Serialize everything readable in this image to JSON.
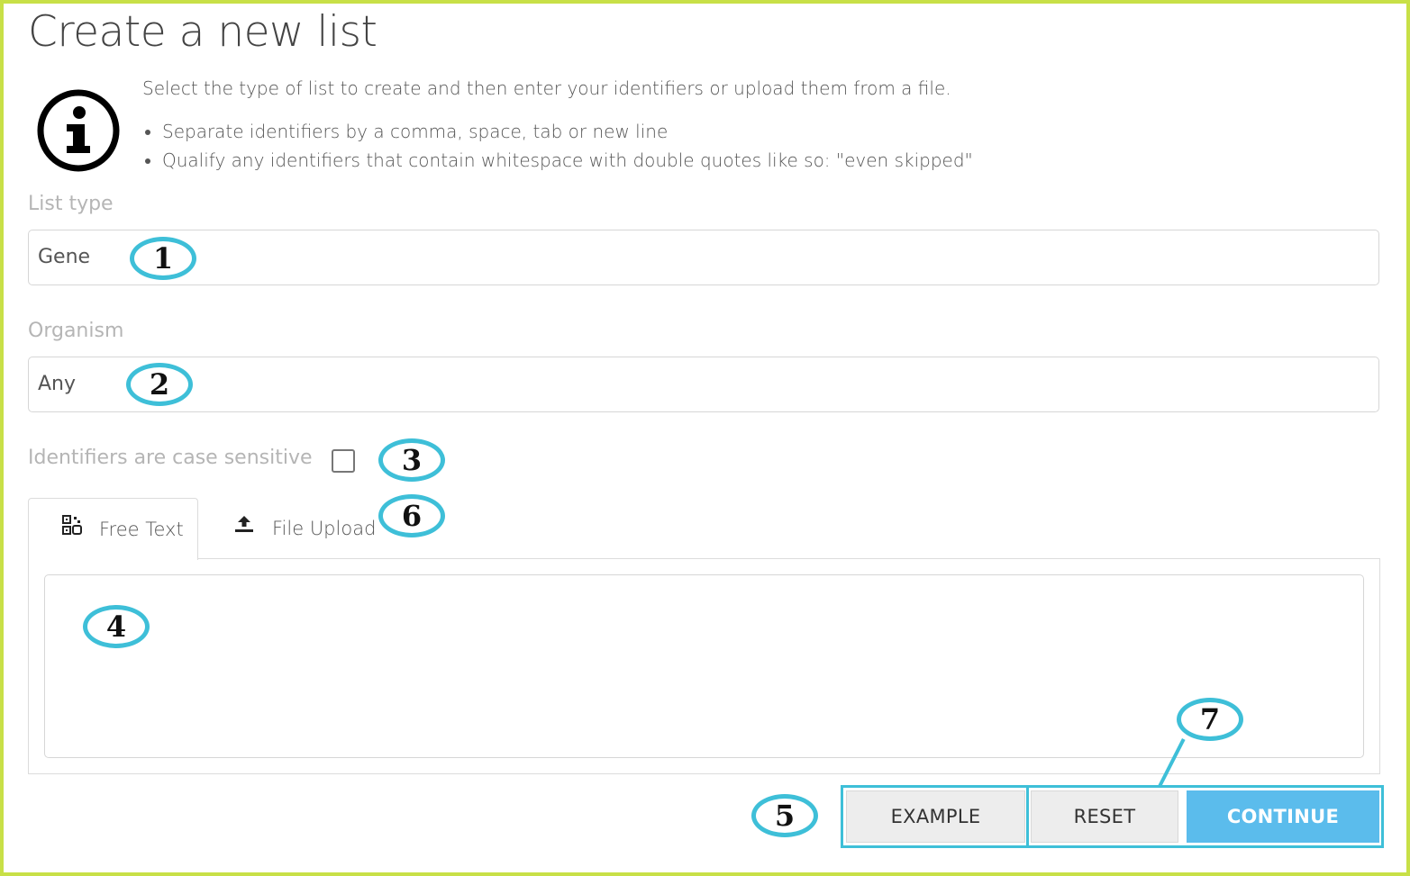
{
  "page": {
    "title": "Create a new list"
  },
  "info": {
    "icon": "info-circle-icon",
    "intro": "Select the type of list to create and then enter your identifiers or upload them from a file.",
    "bullets": [
      "Separate identifiers by a comma, space, tab or new line",
      "Qualify any identifiers that contain whitespace with double quotes like so: \"even skipped\""
    ]
  },
  "form": {
    "list_type": {
      "label": "List type",
      "value": "Gene"
    },
    "organism": {
      "label": "Organism",
      "value": "Any"
    },
    "case_sensitive": {
      "label": "Identifiers are case sensitive",
      "checked": false
    }
  },
  "tabs": [
    {
      "label": "Free Text",
      "icon": "qr-code-icon",
      "active": true
    },
    {
      "label": "File Upload",
      "icon": "upload-icon",
      "active": false
    }
  ],
  "free_text": {
    "value": ""
  },
  "buttons": {
    "example": "EXAMPLE",
    "reset": "RESET",
    "continue": "CONTINUE"
  },
  "callouts": [
    "1",
    "2",
    "3",
    "4",
    "5",
    "6",
    "7"
  ],
  "colors": {
    "callout": "#3ebfd8",
    "frame": "#c8e047",
    "primary_button": "#5bbcec"
  }
}
